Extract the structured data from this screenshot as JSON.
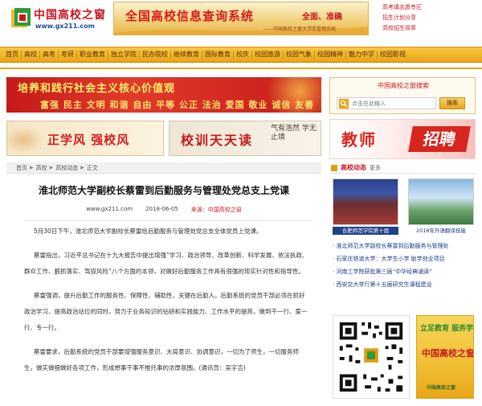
{
  "site": {
    "name": "中国高校之窗",
    "url": "www.gx211.com"
  },
  "banner": {
    "title": "全国高校信息查询系统",
    "slogan": "全面、准确",
    "sub": "——中国高校之窗大学库管理系统"
  },
  "header_links": [
    "高考填志愿专区",
    "招生计划分享",
    "高校招生简章"
  ],
  "nav": {
    "items": [
      "首页",
      "高校",
      "高考",
      "考研",
      "职业教育",
      "独立学院",
      "民办院校",
      "继续教育",
      "国际教育",
      "校庆",
      "校园旅游",
      "校园气象",
      "校园精神",
      "魅力中学",
      "校园影视"
    ]
  },
  "promos": {
    "core_values_title": "培养和践行社会主义核心价值观",
    "core_values_line": "富强 民主 文明 和谐 自由 平等 公正 法治 爱国 敬业 诚信 友善",
    "style_slogan": "正学风 强校风",
    "motto_slogan": "校训天天读",
    "calligraphy": "气有浩然 学无止境"
  },
  "breadcrumb": [
    "首页",
    "高校",
    "高校动态",
    "正文"
  ],
  "article": {
    "title": "淮北师范大学副校长蔡雷到后勤服务与管理处党总支上党课",
    "source_url": "www.gx211.com",
    "date": "2018-06-05",
    "source": "来源：中国高校之窗",
    "paragraphs": [
      "5月30日下午，淮北师范大学副校长蔡雷给后勤服务与管理处党总支全体党员上党课。",
      "蔡雷指出，习近平总书记在十九大报告中提出增强“学习、政治领导、改革创新、科学发展、依法执政、群众工作、狠抓落实、驾驭风险”八个方面的本领，对做好后勤服务工作具有很强的现实针对性和指导性。",
      "蔡雷强调，提升后勤工作的服务性、保障性、辅助性，关键在后勤人。后勤系统的党员干部必须在抓好政治学习、提高政治站位的同时，努力于业务知识的钻研和实践能力、工作水平的提高，做到干一行、爱一行、专一行。",
      "蔡雷要求，后勤系统的党员干部要增强服务意识、大局意识、协调意识，一切为了师生，一切服务师生，做实做细做好各项工作，形成想事干事不推托事的浓厚氛围。(通讯员：吴宇吉)"
    ]
  },
  "sidebar": {
    "search_title": "中国高校之窗搜索",
    "search_placeholder": "点击在此输入",
    "search_button": "搜索",
    "recruit_teacher": "教师",
    "recruit_hire": "招聘",
    "news_section_title": "高校动态",
    "news_more": "更多",
    "thumb_captions": [
      "合肥师范学院第十届",
      "2018年外语翻译技能"
    ],
    "news_items": [
      "· 淮北师范大学副校长蔡雷到后勤服务与管理处",
      "· 石家庄铁道大学：大学生小学 助学创业项目",
      "· 河南工学院获批第三届“中华经典诵读”",
      "· 西安交大举行第十五届研究生课程建设"
    ],
    "qr_ad": {
      "top": "立足教育 服务学生",
      "mid": "中国高校之窗",
      "bot": "中国高校之窗"
    }
  },
  "colors": {
    "brand_red": "#c9181f",
    "nav_gold": "#e9a514",
    "link_blue": "#1a3b8a"
  }
}
